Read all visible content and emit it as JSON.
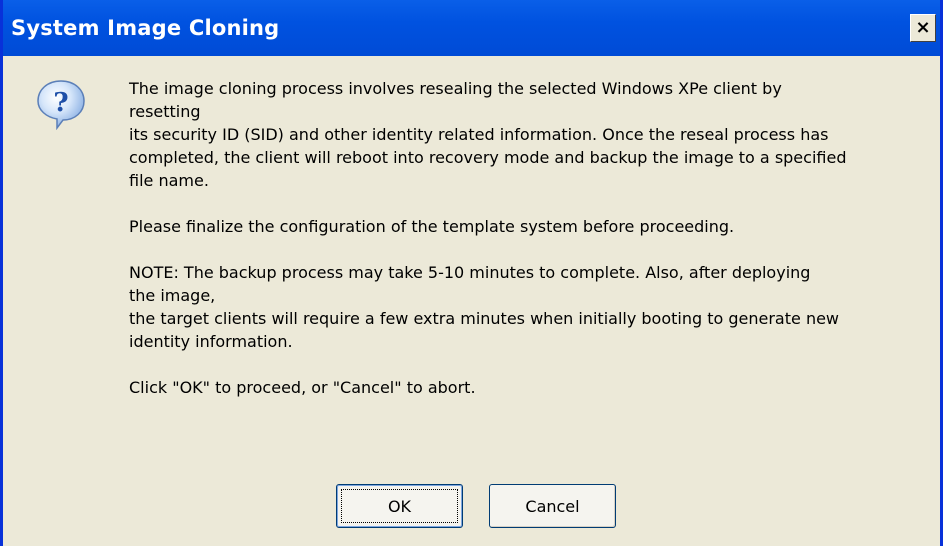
{
  "window": {
    "title": "System Image Cloning",
    "close_glyph": "×"
  },
  "icon": {
    "name": "question-icon",
    "glyph": "?"
  },
  "message": {
    "paragraph1_lines": [
      "The image cloning process involves resealing the selected Windows XPe client by",
      "resetting",
      "its security ID (SID) and other identity related information. Once the reseal process has",
      "completed, the client will reboot into recovery mode and backup the image to a specified",
      "file name."
    ],
    "paragraph2": "Please finalize the configuration of the template system before proceeding.",
    "paragraph3_lines": [
      "NOTE: The backup process may take 5-10 minutes to complete. Also, after deploying",
      "the image,",
      "the target clients will require a few extra minutes when initially booting to generate new",
      "identity information."
    ],
    "paragraph4": "Click \"OK\" to proceed, or \"Cancel\" to abort."
  },
  "buttons": {
    "ok_label": "OK",
    "cancel_label": "Cancel"
  },
  "colors": {
    "titlebar": "#0052E0",
    "dialog_background": "#ECE9D8",
    "button_border": "#003C74",
    "icon_blue": "#1E64C8"
  }
}
